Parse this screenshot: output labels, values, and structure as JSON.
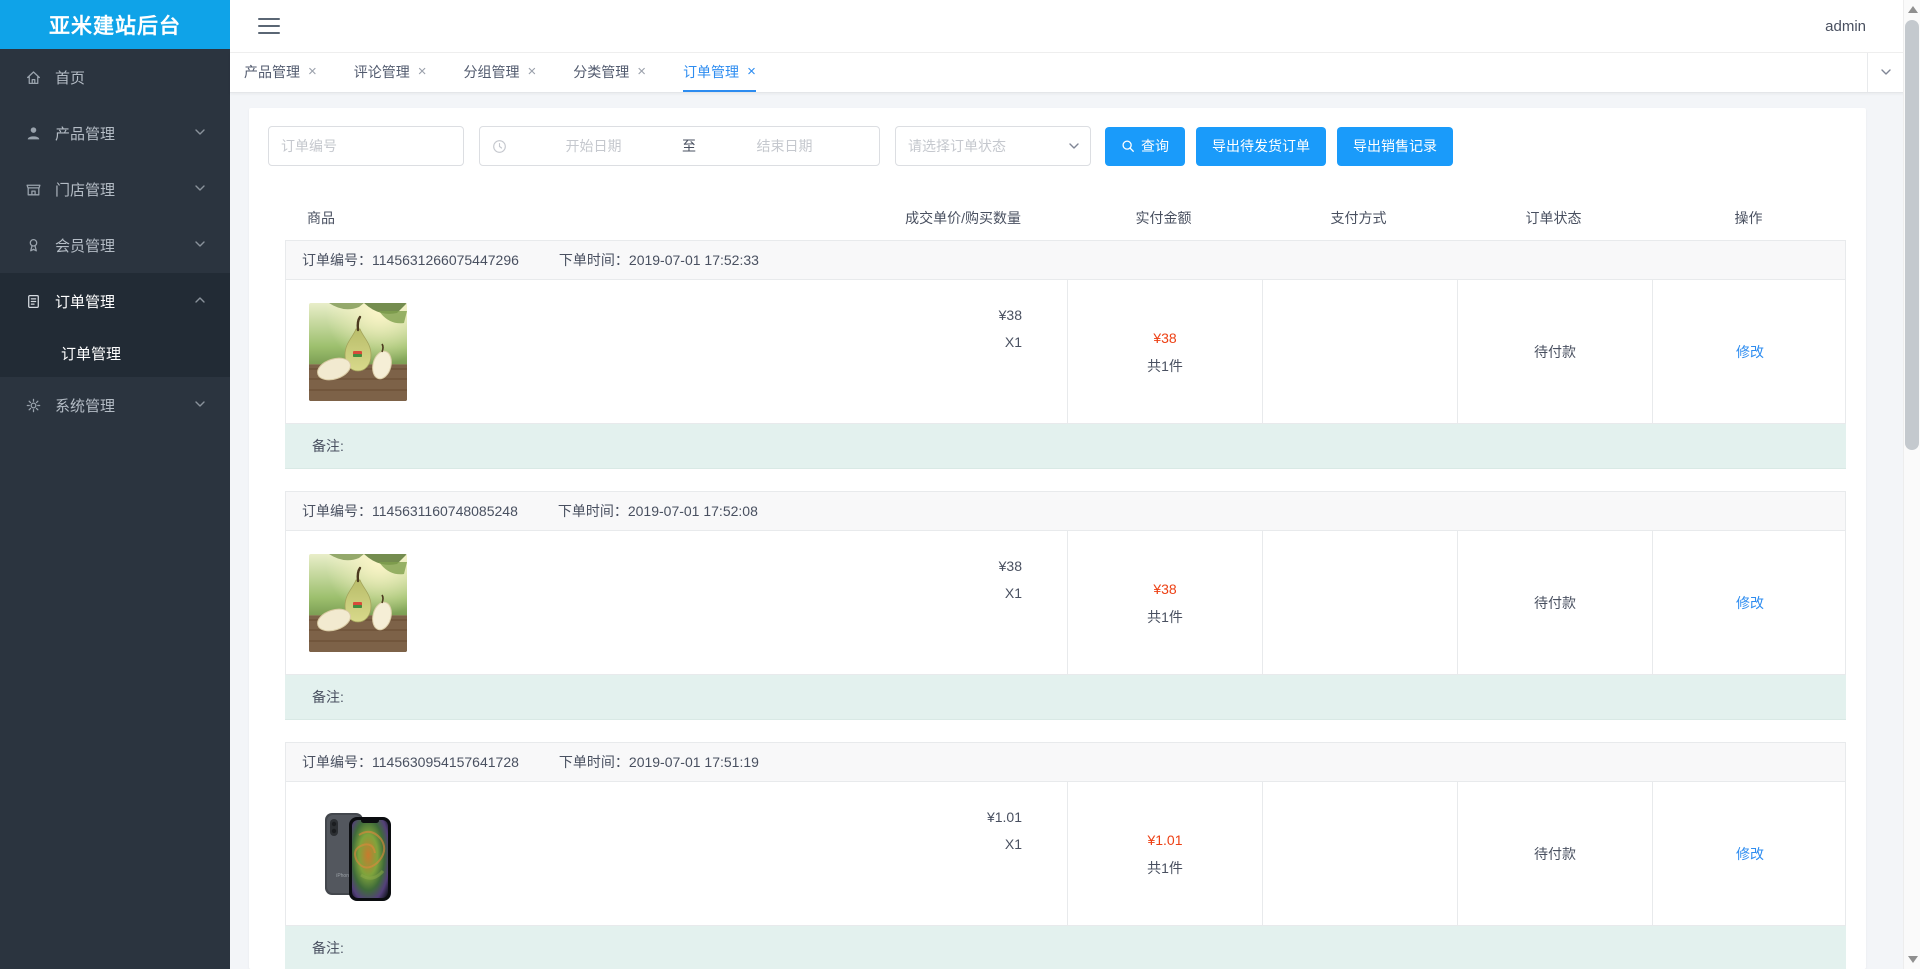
{
  "app": {
    "logo_title": "亚米建站后台",
    "username": "admin"
  },
  "sidebar": {
    "items": [
      {
        "label": "首页",
        "icon": "home-icon",
        "expandable": false
      },
      {
        "label": "产品管理",
        "icon": "user-icon",
        "expandable": true
      },
      {
        "label": "门店管理",
        "icon": "store-icon",
        "expandable": true
      },
      {
        "label": "会员管理",
        "icon": "member-icon",
        "expandable": true
      },
      {
        "label": "订单管理",
        "icon": "order-icon",
        "expandable": true,
        "expanded": true
      },
      {
        "label": "系统管理",
        "icon": "gear-icon",
        "expandable": true
      }
    ],
    "submenu": {
      "label": "订单管理",
      "active": true
    }
  },
  "tabs": [
    {
      "label": "产品管理"
    },
    {
      "label": "评论管理"
    },
    {
      "label": "分组管理"
    },
    {
      "label": "分类管理"
    },
    {
      "label": "订单管理",
      "active": true
    }
  ],
  "ui": {
    "close_glyph": "×"
  },
  "filters": {
    "order_no_placeholder": "订单编号",
    "date_start_placeholder": "开始日期",
    "date_separator": "至",
    "date_end_placeholder": "结束日期",
    "status_placeholder": "请选择订单状态",
    "search_label": "查询",
    "export_pending_label": "导出待发货订单",
    "export_sales_label": "导出销售记录"
  },
  "table": {
    "headers": [
      "商品",
      "成交单价/购买数量",
      "实付金额",
      "支付方式",
      "订单状态",
      "操作"
    ]
  },
  "labels": {
    "order_no_prefix": "订单编号：",
    "order_time_prefix": "下单时间：",
    "remark": "备注:"
  },
  "orders": [
    {
      "order_no": "1145631266075447296",
      "order_time": "2019-07-01 17:52:33",
      "product_image": "pear",
      "unit_price": "¥38",
      "quantity": "X1",
      "paid_amount": "¥38",
      "total_count": "共1件",
      "pay_method": "",
      "status": "待付款",
      "action": "修改"
    },
    {
      "order_no": "1145631160748085248",
      "order_time": "2019-07-01 17:52:08",
      "product_image": "pear",
      "unit_price": "¥38",
      "quantity": "X1",
      "paid_amount": "¥38",
      "total_count": "共1件",
      "pay_method": "",
      "status": "待付款",
      "action": "修改"
    },
    {
      "order_no": "1145630954157641728",
      "order_time": "2019-07-01 17:51:19",
      "product_image": "iphone",
      "unit_price": "¥1.01",
      "quantity": "X1",
      "paid_amount": "¥1.01",
      "total_count": "共1件",
      "pay_method": "",
      "status": "待付款",
      "action": "修改"
    }
  ],
  "colors": {
    "logo_background": "#0fa3e8",
    "primary_button": "#1a9bfa",
    "active_tab": "#2d8cf0",
    "price_red": "#ed4014",
    "sidebar_background": "#2b343f",
    "remark_background": "#e3f1ee"
  }
}
